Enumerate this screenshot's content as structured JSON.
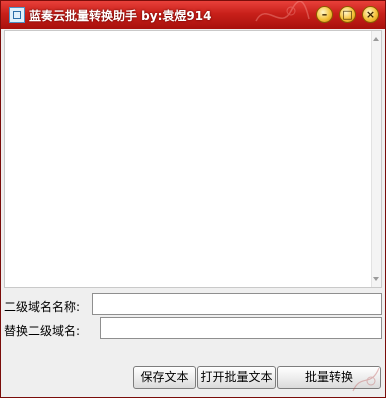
{
  "window": {
    "title": "蓝奏云批量转换助手 by:袁煜914",
    "minimize_glyph": "–",
    "maximize_glyph": "□",
    "close_glyph": "×"
  },
  "form": {
    "secondary_domain_label": "二级域名名称:",
    "secondary_domain_value": "",
    "replace_domain_label": "替换二级域名:",
    "replace_domain_value": ""
  },
  "buttons": {
    "save_label": "保存文本",
    "open_label": "打开批量文本",
    "convert_label": "批量转换"
  },
  "colors": {
    "titlebar": "#c8201a",
    "window_bg": "#efefef"
  }
}
